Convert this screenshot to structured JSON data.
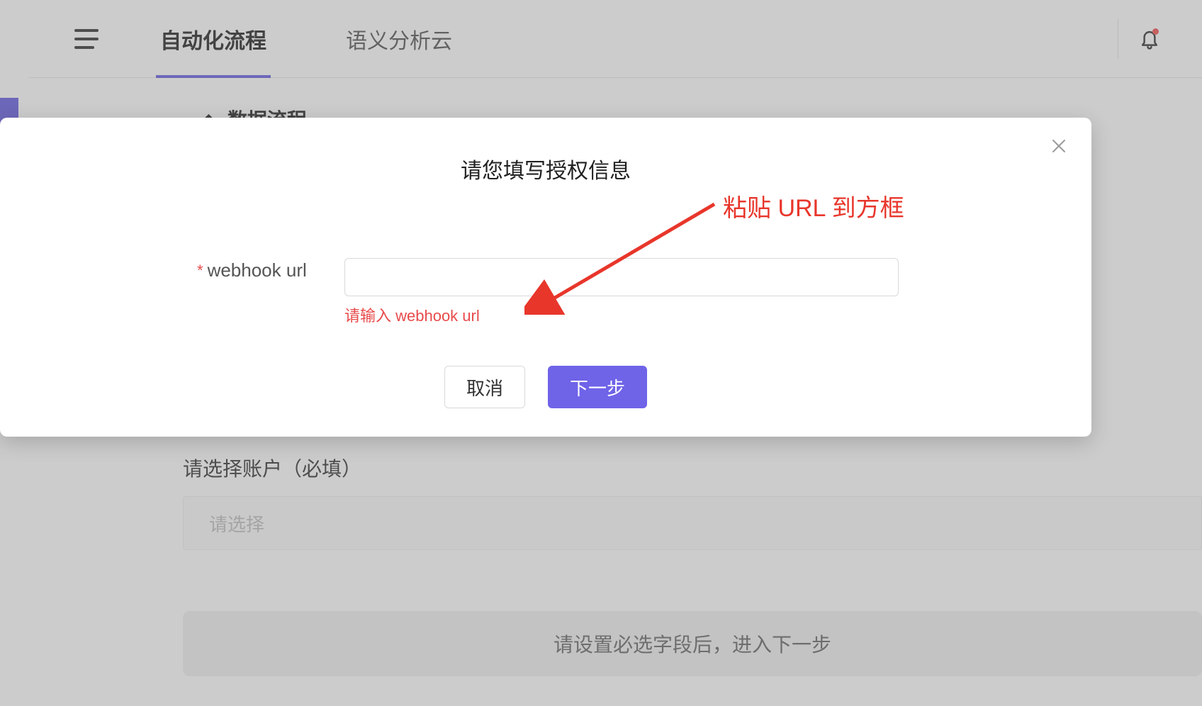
{
  "header": {
    "tabs": [
      {
        "label": "自动化流程",
        "active": true
      },
      {
        "label": "语义分析云",
        "active": false
      }
    ],
    "icons": {
      "menu": "menu-icon",
      "bell": "bell-icon"
    }
  },
  "background": {
    "sub_tab_partial": "数据流程",
    "account_section_label": "请选择账户（必填）",
    "account_select_placeholder": "请选择",
    "cta_disabled_text": "请设置必选字段后，进入下一步"
  },
  "modal": {
    "title": "请您填写授权信息",
    "field": {
      "label": "webhook url",
      "required": true,
      "value": "",
      "error": "请输入 webhook url"
    },
    "actions": {
      "cancel": "取消",
      "next": "下一步"
    },
    "annotation": "粘贴 URL 到方框"
  },
  "colors": {
    "accent": "#675ce0",
    "error": "#e84b4b",
    "annotation": "#e8362b"
  }
}
